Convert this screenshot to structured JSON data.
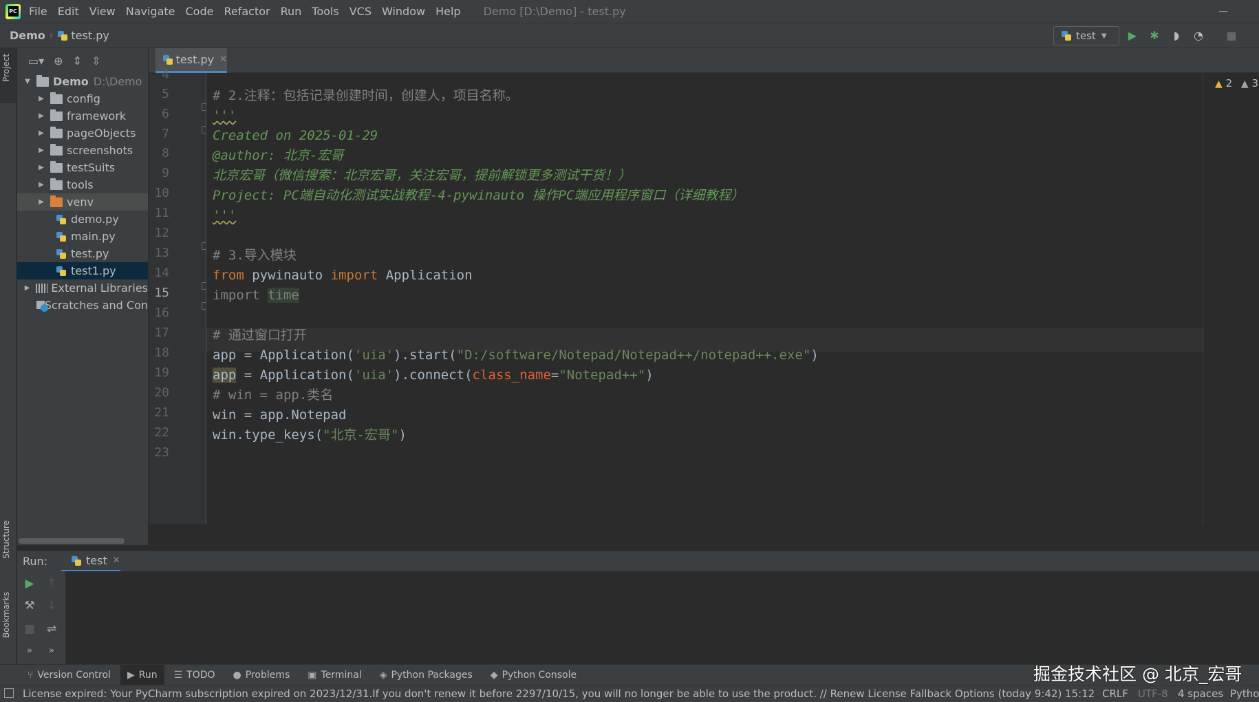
{
  "menubar": {
    "logo_text": "PC",
    "items": [
      "File",
      "Edit",
      "View",
      "Navigate",
      "Code",
      "Refactor",
      "Run",
      "Tools",
      "VCS",
      "Window",
      "Help"
    ],
    "window_title": "Demo [D:\\Demo] - test.py"
  },
  "navbar": {
    "project": "Demo",
    "file": "test.py",
    "run_config": "test"
  },
  "left_stripe": {
    "project": "Project",
    "structure": "Structure",
    "bookmarks": "Bookmarks"
  },
  "project_tree": {
    "root_name": "Demo",
    "root_path": "D:\\Demo",
    "items": [
      {
        "label": "config",
        "type": "folder"
      },
      {
        "label": "framework",
        "type": "folder"
      },
      {
        "label": "pageObjects",
        "type": "folder"
      },
      {
        "label": "screenshots",
        "type": "folder"
      },
      {
        "label": "testSuits",
        "type": "folder"
      },
      {
        "label": "tools",
        "type": "folder"
      },
      {
        "label": "venv",
        "type": "folder-excluded"
      },
      {
        "label": "demo.py",
        "type": "python-file"
      },
      {
        "label": "main.py",
        "type": "python-file"
      },
      {
        "label": "test.py",
        "type": "python-file"
      },
      {
        "label": "test1.py",
        "type": "python-file"
      }
    ],
    "external_libraries": "External Libraries",
    "scratches": "Scratches and Con"
  },
  "editor": {
    "tab_label": "test.py",
    "current_line": 15,
    "line_numbers": [
      "4",
      "5",
      "6",
      "7",
      "8",
      "9",
      "10",
      "11",
      "12",
      "13",
      "14",
      "15",
      "16",
      "17",
      "18",
      "19",
      "20",
      "21",
      "22",
      "23"
    ],
    "code": {
      "l5": "# 2.注释：包括记录创建时间，创建人，项目名称。",
      "l6": "'''",
      "l7": "Created on 2025-01-29",
      "l8": "@author: 北京-宏哥",
      "l9": "北京宏哥（微信搜索：北京宏哥，关注宏哥，提前解锁更多测试干货！）",
      "l10": "Project: PC端自动化测试实战教程-4-pywinauto 操作PC端应用程序窗口（详细教程）",
      "l11": "'''",
      "l13": "# 3.导入模块",
      "l14_kw1": "from",
      "l14_mod": " pywinauto ",
      "l14_kw2": "import",
      "l14_name": " Application",
      "l15_kw": "import",
      "l15_mod": "time",
      "l17": "# 通过窗口打开",
      "l18_pre": "app = Application(",
      "l18_s1": "'uia'",
      "l18_mid": ").start(",
      "l18_s2": "\"D:/software/Notepad/Notepad++/notepad++.exe\"",
      "l18_end": ")",
      "l19_app": "app",
      "l19_pre": " = Application(",
      "l19_s1": "'uia'",
      "l19_mid": ").connect(",
      "l19_param": "class_name",
      "l19_eq": "=",
      "l19_s2": "\"Notepad++\"",
      "l19_end": ")",
      "l20": "# win = app.类名",
      "l21": "win = app.Notepad",
      "l22_pre": "win.type_keys(",
      "l22_s": "\"北京-宏哥\"",
      "l22_end": ")"
    },
    "warnings_count": "2",
    "weak_warnings_count": "3"
  },
  "run_panel": {
    "label": "Run:",
    "tab": "test"
  },
  "bottom_toolbar": {
    "items": [
      {
        "icon": "branch-icon",
        "label": "Version Control"
      },
      {
        "icon": "play-icon",
        "label": "Run"
      },
      {
        "icon": "list-icon",
        "label": "TODO"
      },
      {
        "icon": "info-icon",
        "label": "Problems"
      },
      {
        "icon": "terminal-icon",
        "label": "Terminal"
      },
      {
        "icon": "layers-icon",
        "label": "Python Packages"
      },
      {
        "icon": "python-icon",
        "label": "Python Console"
      }
    ]
  },
  "watermark": "掘金技术社区 @ 北京_宏哥",
  "statusbar": {
    "message": "License expired: Your PyCharm subscription expired on 2023/12/31.If you don't renew it before 2297/10/15, you will no longer be able to use the product. // Renew License   Fallback Options (today 9:42)",
    "position": "15:12",
    "line_sep": "CRLF",
    "encoding": "UTF-8",
    "indent": "4 spaces",
    "interpreter": "Pytho"
  }
}
